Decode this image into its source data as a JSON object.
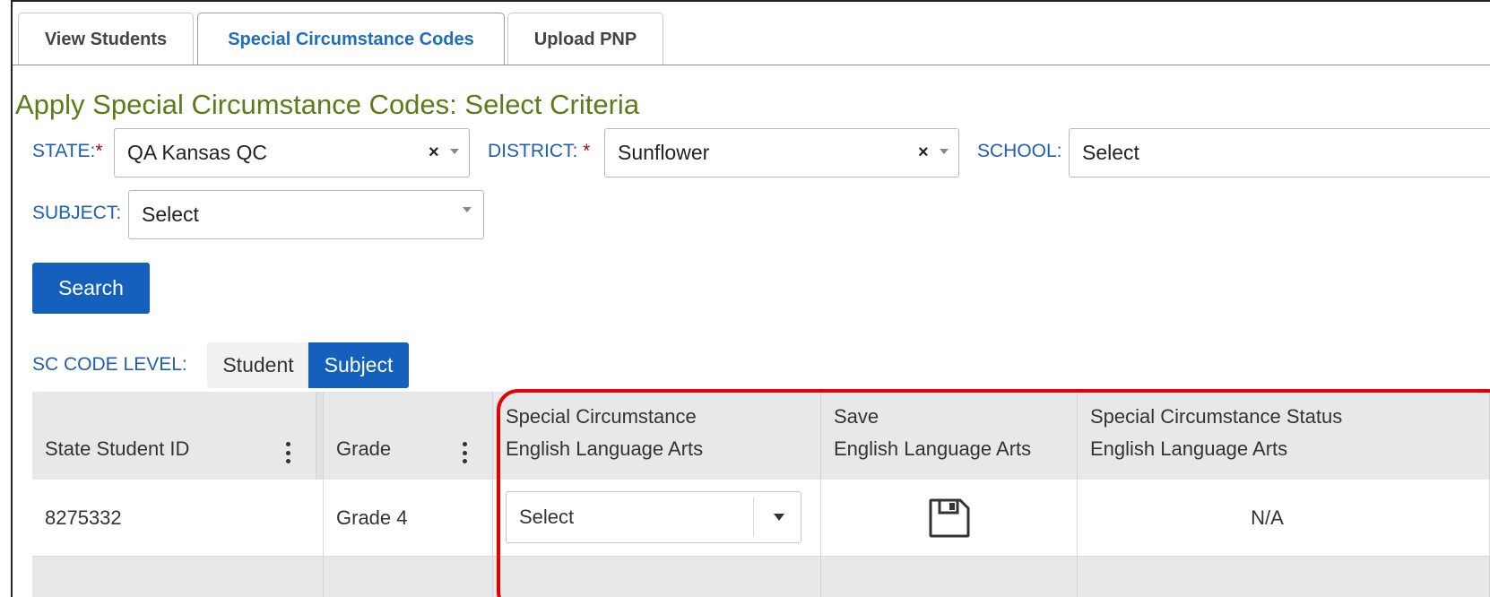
{
  "tabs": [
    {
      "label": "View Students",
      "active": false
    },
    {
      "label": "Special Circumstance Codes",
      "active": true
    },
    {
      "label": "Upload PNP",
      "active": false
    }
  ],
  "page": {
    "title": "Apply Special Circumstance Codes: Select Criteria"
  },
  "filters": {
    "state": {
      "label": "STATE:",
      "required": "*",
      "value": "QA Kansas QC"
    },
    "district": {
      "label": "DISTRICT: ",
      "required": "*",
      "value": "Sunflower"
    },
    "school": {
      "label": "SCHOOL:",
      "value": "Select"
    },
    "subject": {
      "label": "SUBJECT:",
      "value": "Select"
    }
  },
  "search_button": "Search",
  "sc_code_level": {
    "label": "SC CODE LEVEL:",
    "options": [
      "Student",
      "Subject"
    ],
    "selected": "Subject"
  },
  "grid": {
    "columns": [
      {
        "line1": "",
        "line2": "State Student ID"
      },
      {
        "line1": "",
        "line2": "Grade"
      },
      {
        "line1": "Special Circumstance",
        "line2": "English Language Arts"
      },
      {
        "line1": "Save",
        "line2": "English Language Arts"
      },
      {
        "line1": "Special Circumstance Status",
        "line2": "English Language Arts"
      }
    ],
    "rows": [
      {
        "student_id": "8275332",
        "grade": "Grade 4",
        "sc_select": "Select",
        "save_icon": "floppy-disk-icon",
        "status": "N/A"
      }
    ]
  },
  "colors": {
    "accent": "#1560bd",
    "title": "#5a7d1a",
    "label": "#1f5fb3",
    "highlight": "#e60000"
  }
}
